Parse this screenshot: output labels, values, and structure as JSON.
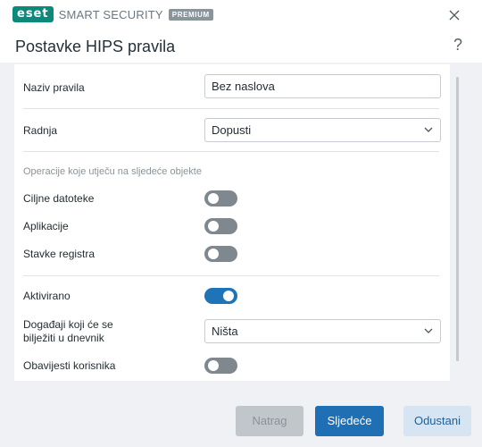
{
  "titlebar": {
    "brand": "eset",
    "product": "SMART SECURITY",
    "edition": "PREMIUM"
  },
  "header": {
    "title": "Postavke HIPS pravila",
    "help": "?"
  },
  "form": {
    "rule_name_label": "Naziv pravila",
    "rule_name_value": "Bez naslova",
    "action_label": "Radnja",
    "action_value": "Dopusti",
    "operations_label": "Operacije koje utječu na sljedeće objekte",
    "target_files_label": "Ciljne datoteke",
    "target_files_on": false,
    "applications_label": "Aplikacije",
    "applications_on": false,
    "registry_label": "Stavke registra",
    "registry_on": false,
    "enabled_label": "Aktivirano",
    "enabled_on": true,
    "log_events_label_line1": "Događaji koji će se",
    "log_events_label_line2": "bilježiti u dnevnik",
    "log_events_value": "Ništa",
    "notify_user_label": "Obavijesti korisnika",
    "notify_user_on": false
  },
  "buttons": {
    "back": "Natrag",
    "next": "Sljedeće",
    "cancel": "Odustani"
  },
  "colors": {
    "brand": "#0b8a7a",
    "accent": "#1f6fb5",
    "toggle_off": "#7f888f"
  },
  "icons": {
    "close": "close-icon",
    "chevron": "chevron-down-icon"
  }
}
